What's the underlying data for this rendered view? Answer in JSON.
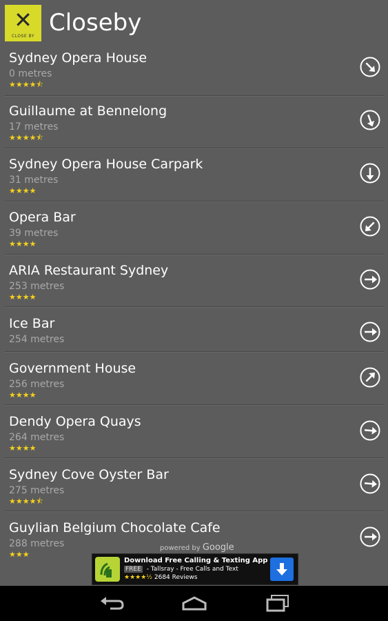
{
  "app": {
    "title": "Closeby",
    "logo_text": "CLOSE BY"
  },
  "places": [
    {
      "name": "Sydney Opera House",
      "distance": "0 metres",
      "rating": 4.5,
      "direction_deg": 135
    },
    {
      "name": "Guillaume at Bennelong",
      "distance": "17 metres",
      "rating": 4.5,
      "direction_deg": 160
    },
    {
      "name": "Sydney Opera House Carpark",
      "distance": "31 metres",
      "rating": 4,
      "direction_deg": 180
    },
    {
      "name": "Opera Bar",
      "distance": "39 metres",
      "rating": 4,
      "direction_deg": 225
    },
    {
      "name": "ARIA Restaurant Sydney",
      "distance": "253 metres",
      "rating": 4,
      "direction_deg": 90
    },
    {
      "name": "Ice Bar",
      "distance": "254 metres",
      "rating": 0,
      "direction_deg": 90
    },
    {
      "name": "Government House",
      "distance": "256 metres",
      "rating": 4,
      "direction_deg": 45
    },
    {
      "name": "Dendy Opera Quays",
      "distance": "264 metres",
      "rating": 4,
      "direction_deg": 95
    },
    {
      "name": "Sydney Cove Oyster Bar",
      "distance": "275 metres",
      "rating": 4.5,
      "direction_deg": 95
    },
    {
      "name": "Guylian Belgium Chocolate Cafe",
      "distance": "288 metres",
      "rating": 3,
      "direction_deg": 90
    }
  ],
  "attribution": {
    "prefix": "powered by",
    "brand": "Google"
  },
  "ad": {
    "line1": "Download Free Calling & Texting App",
    "badge": "FREE",
    "line2": "- Tallsray - Free Calls and Text",
    "stars": "★★★★½",
    "reviews": "2684 Reviews"
  },
  "colors": {
    "background": "#5c5c5c",
    "logo": "#d8da2a",
    "stars": "#f6d21b",
    "ad_button": "#1e6fe0"
  },
  "icons": {
    "back": "back-icon",
    "home": "home-icon",
    "recents": "recent-apps-icon",
    "direction": "direction-arrow-icon",
    "download": "download-icon"
  }
}
